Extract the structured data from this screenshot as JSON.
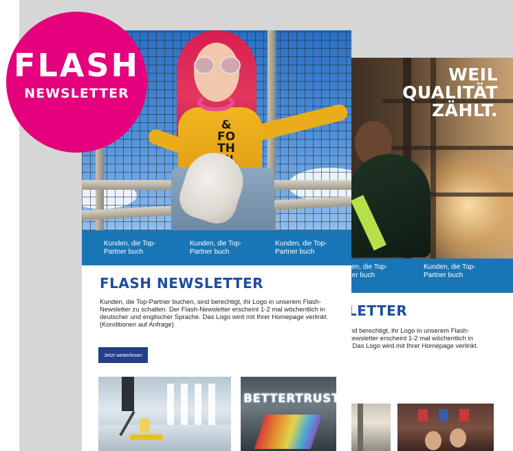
{
  "badge": {
    "line1": "FLASH",
    "line2": "NEWSLETTER",
    "color": "#e5007d"
  },
  "front_card": {
    "hero_shirt_text": "&\nFO\nTH\nKIL",
    "blue_bar": {
      "color": "#1976b6",
      "cells": [
        "Kunden, die Top-Partner buch",
        "Kunden, die Top-Partner buch",
        "Kunden, die Top-Partner buch"
      ]
    },
    "title": "FLASH NEWSLETTER",
    "body": "Kunden, die Top-Partner buchen, sind berechtigt, ihr Logo in unserem Flash-Newsletter zu schalten. Der Flash-Newsletter erscheint 1-2 mal wöchentlich in deutscher und englischer Sprache. Das Logo wird mit Ihrer Homepage verlinkt. (Konditionen auf Anfrage)",
    "button_label": "Jetzt weiterlesen",
    "thumb2_label": "BETTERTRUST"
  },
  "back_card": {
    "headline": "WEIL\nQUALITÄT\nZÄHLT.",
    "blue_bar": {
      "cells": [
        "nden, die Top-\nrtner buch",
        "Kunden, die Top-\nPartner buch"
      ]
    },
    "title": "LETTER",
    "body": "sind berechtigt, ihr Logo in unserem Flash-\n-Newsletter erscheint 1-2 mal wöchentlich in\ne. Das Logo wird mit Ihrer Homepage verlinkt."
  },
  "colors": {
    "title_blue": "#1e4da0",
    "button_bg": "#243e8c",
    "background_grey": "#d6d6d6"
  }
}
